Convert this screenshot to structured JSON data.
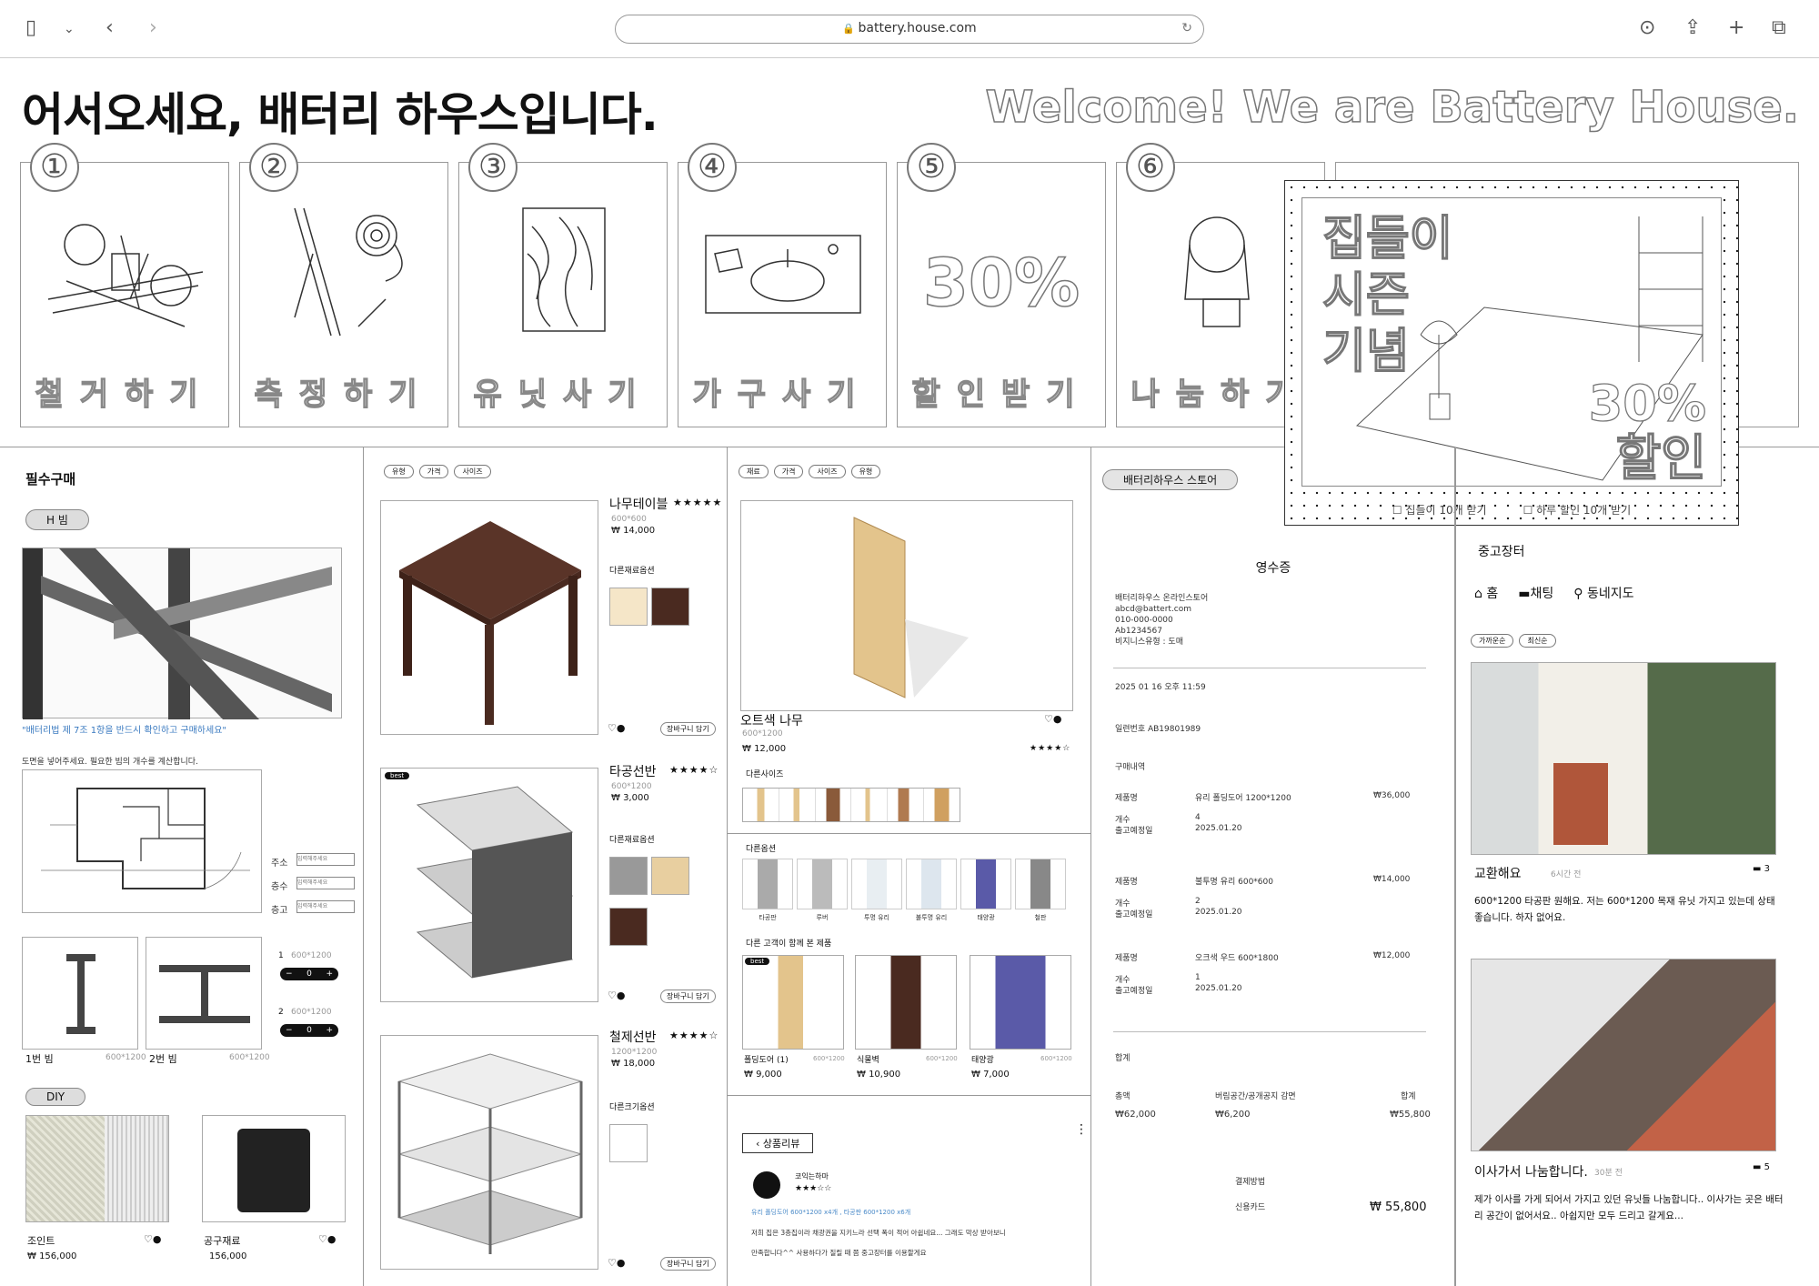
{
  "browser": {
    "url": "battery.house.com",
    "icons": [
      "sidebar-icon",
      "chevron-down-icon",
      "back-icon",
      "forward-icon",
      "download-icon",
      "share-icon",
      "plus-icon",
      "tabs-icon",
      "reload-icon",
      "lock-icon"
    ]
  },
  "hero": {
    "title": "어서오세요, 배터리 하우스입니다.",
    "subtitle_en": "Welcome! We are Battery House.",
    "steps": [
      {
        "num": "①",
        "label": "철거하기"
      },
      {
        "num": "②",
        "label": "측정하기"
      },
      {
        "num": "③",
        "label": "유닛사기"
      },
      {
        "num": "④",
        "label": "가구사기"
      },
      {
        "num": "⑤",
        "label": "할인받기",
        "promo": "30%"
      },
      {
        "num": "⑥",
        "label": "나눔하기"
      }
    ]
  },
  "promo": {
    "title": [
      "집들이",
      "시즌",
      "기념"
    ],
    "discount": [
      "30%",
      "할인"
    ],
    "opt1": "☐ 집들이 10개 받기",
    "opt2": "☐ 하루 할인 10개 받기"
  },
  "col1": {
    "title": "필수구매",
    "tag1": "H 빔",
    "notice": "\"배터리법 제 7조 1항을 반드시 확인하고 구매하세요\"",
    "upload": "도면을 넣어주세요. 필요한 빔의 개수를 계산합니다.",
    "fields": [
      {
        "label": "주소",
        "placeholder": "입력해주세요"
      },
      {
        "label": "층수",
        "placeholder": "입력해주세요"
      },
      {
        "label": "층고",
        "placeholder": "입력해주세요"
      }
    ],
    "beams": [
      {
        "name": "1번 빔",
        "size": "600*1200",
        "n": "1",
        "qty": "0"
      },
      {
        "name": "2번 빔",
        "size": "600*1200",
        "n": "2",
        "qty": "0"
      }
    ],
    "tag2": "DIY",
    "diy": [
      {
        "name": "조인트",
        "price": "₩ 156,000"
      },
      {
        "name": "공구재료",
        "price": "156,000"
      }
    ]
  },
  "col2": {
    "filters": [
      "유형",
      "가격",
      "사이즈"
    ],
    "products": [
      {
        "name": "나무테이블",
        "stars": "★★★★★",
        "size": "600*600",
        "price": "₩ 14,000",
        "opt": "다른재료옵션",
        "cart": "장바구니 담기",
        "badge": ""
      },
      {
        "name": "타공선반",
        "stars": "★★★★☆",
        "size": "600*1200",
        "price": "₩ 3,000",
        "opt": "다른재료옵션",
        "cart": "장바구니 담기",
        "badge": "best"
      },
      {
        "name": "철제선반",
        "stars": "★★★★☆",
        "size": "1200*1200",
        "price": "₩ 18,000",
        "opt": "다른크기옵션",
        "cart": "장바구니 담기",
        "badge": ""
      }
    ]
  },
  "col3": {
    "filters": [
      "재료",
      "가격",
      "사이즈",
      "유형"
    ],
    "name": "오트색 나무",
    "size": "600*1200",
    "price": "₩ 12,000",
    "stars": "★★★★☆",
    "sizes_label": "다른사이즈",
    "opt_label": "다른옵션",
    "opts": [
      "타공판",
      "루버",
      "투명 유리",
      "불투명 유리",
      "태양광",
      "철판"
    ],
    "related_label": "다른 고객이 함께 본 제품",
    "related": [
      {
        "name": "폴딩도어 (1)",
        "size": "600*1200",
        "price": "₩ 9,000",
        "badge": "best"
      },
      {
        "name": "식물벽",
        "size": "600*1200",
        "price": "₩ 10,900"
      },
      {
        "name": "태양광",
        "size": "600*1200",
        "price": "₩ 7,000"
      }
    ],
    "review": {
      "title": "상품리뷰",
      "user": "코익는하마",
      "stars": "★★★☆☆",
      "items": "유리 폴딩도어 600*1200 x4개 , 타공판 600*1200 x6개",
      "text1": "저희 집은 3층집이라 채광권을 지키느라 선택 폭이 적어 아쉽네요... 그래도 막상 받아보니",
      "text2": "만족합니다^^ 사용하다가 질릴 때 쯤 중고장터를 이용할게요"
    }
  },
  "col4": {
    "tag": "배터리하우스 스토어",
    "title": "영수증",
    "store": [
      "배터리하우스 온라인스토어",
      "abcd@battert.com",
      "010-000-0000",
      "Ab1234567",
      "비지니스유형 : 도매"
    ],
    "date": "2025 01 16 오후 11:59",
    "serial": "일련번호 AB19801989",
    "section": "구매내역",
    "items": [
      {
        "name": "유리 폴딩도어 1200*1200",
        "price": "₩36,000",
        "qty": "4",
        "date": "2025.01.20"
      },
      {
        "name": "불투명 유리 600*600",
        "price": "₩14,000",
        "qty": "2",
        "date": "2025.01.20"
      },
      {
        "name": "오크색 우드 600*1800",
        "price": "₩12,000",
        "qty": "1",
        "date": "2025.01.20"
      }
    ],
    "lbl_name": "제품명",
    "lbl_qty": "개수",
    "lbl_date": "출고예정일",
    "sum_title": "합계",
    "sum_cols": [
      "총액",
      "버림공간/공개공지 감면",
      "합계"
    ],
    "sum_vals": [
      "₩62,000",
      "₩6,200",
      "₩55,800"
    ],
    "pay_label": "결제방법",
    "pay_method": "신용카드",
    "pay_total": "₩ 55,800"
  },
  "col5": {
    "title": "중고장터",
    "nav": [
      "홈",
      "채팅",
      "동네지도"
    ],
    "filters": [
      "가까운순",
      "최신순"
    ],
    "posts": [
      {
        "title": "교환해요",
        "time": "6시간 전",
        "count": "3",
        "body": "600*1200 타공판 원해요. 저는 600*1200 목재 유닛 가지고 있는데 상태 좋습니다. 하자 없어요."
      },
      {
        "title": "이사가서 나눔합니다.",
        "time": "30분 전",
        "count": "5",
        "body": "제가 이사를 가게 되어서 가지고 있던 유닛들 나눔합니다.. 이사가는 곳은 배터리 공간이 없어서요.. 아쉽지만 모두 드리고 갈게요..."
      }
    ]
  },
  "colors": {
    "wood": "#4a2a20",
    "oak": "#e3c48c",
    "solar": "#5a5aa8",
    "steel": "#555555"
  }
}
